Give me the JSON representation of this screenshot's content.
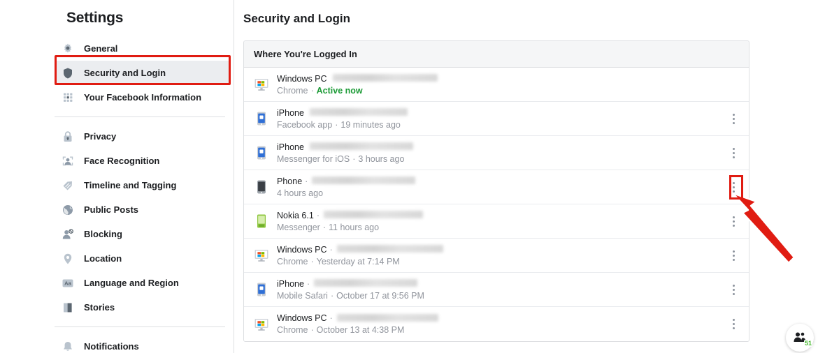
{
  "sidebar": {
    "title": "Settings",
    "groups": [
      {
        "items": [
          {
            "label": "General",
            "icon": "gear-icon",
            "active": false
          },
          {
            "label": "Security and Login",
            "icon": "shield-icon",
            "active": true
          },
          {
            "label": "Your Facebook Information",
            "icon": "grid-dots-icon",
            "active": false
          }
        ]
      },
      {
        "items": [
          {
            "label": "Privacy",
            "icon": "lock-icon",
            "active": false
          },
          {
            "label": "Face Recognition",
            "icon": "face-scan-icon",
            "active": false
          },
          {
            "label": "Timeline and Tagging",
            "icon": "tag-icon",
            "active": false
          },
          {
            "label": "Public Posts",
            "icon": "globe-icon",
            "active": false
          },
          {
            "label": "Blocking",
            "icon": "block-user-icon",
            "active": false
          },
          {
            "label": "Location",
            "icon": "map-pin-icon",
            "active": false
          },
          {
            "label": "Language and Region",
            "icon": "language-aa-icon",
            "active": false
          },
          {
            "label": "Stories",
            "icon": "book-icon",
            "active": false
          }
        ]
      },
      {
        "items": [
          {
            "label": "Notifications",
            "icon": "bell-icon",
            "active": false
          }
        ]
      }
    ]
  },
  "main": {
    "page_title": "Security and Login",
    "card": {
      "header": "Where You're Logged In",
      "rows": [
        {
          "device": "Windows PC",
          "icon": "windows-pc-icon",
          "redacted": true,
          "redact_width": 150,
          "has_separator": false,
          "app": "Chrome",
          "time": "Active now",
          "active": true,
          "kebab": false
        },
        {
          "device": "iPhone",
          "icon": "iphone-icon",
          "redacted": true,
          "redact_width": 140,
          "has_separator": false,
          "app": "Facebook app",
          "time": "19 minutes ago",
          "active": false,
          "kebab": true
        },
        {
          "device": "iPhone",
          "icon": "iphone-icon",
          "redacted": true,
          "redact_width": 148,
          "has_separator": false,
          "app": "Messenger for iOS",
          "time": "3 hours ago",
          "active": false,
          "kebab": true
        },
        {
          "device": "Phone",
          "icon": "phone-grey-icon",
          "redacted": true,
          "redact_width": 148,
          "has_separator": true,
          "app": "",
          "time": "4 hours ago",
          "active": false,
          "kebab": true
        },
        {
          "device": "Nokia 6.1",
          "icon": "nokia-green-icon",
          "redacted": true,
          "redact_width": 142,
          "has_separator": true,
          "app": "Messenger",
          "time": "11 hours ago",
          "active": false,
          "kebab": true
        },
        {
          "device": "Windows PC",
          "icon": "windows-pc-icon",
          "redacted": true,
          "redact_width": 152,
          "has_separator": true,
          "app": "Chrome",
          "time": "Yesterday at 7:14 PM",
          "active": false,
          "kebab": true
        },
        {
          "device": "iPhone",
          "icon": "iphone-icon",
          "redacted": true,
          "redact_width": 148,
          "has_separator": true,
          "app": "Mobile Safari",
          "time": "October 17 at 9:56 PM",
          "active": false,
          "kebab": true
        },
        {
          "device": "Windows PC",
          "icon": "windows-pc-icon",
          "redacted": true,
          "redact_width": 145,
          "has_separator": true,
          "app": "Chrome",
          "time": "October 13 at 4:38 PM",
          "active": false,
          "kebab": true
        }
      ]
    }
  },
  "annotations": {
    "highlight_color": "#e01c12",
    "highlight_security_label": "Security and Login",
    "highlight_kebab_row": "Phone",
    "arrow_color": "#e01c12"
  },
  "chat_widget": {
    "icon": "contacts-icon",
    "badge": "51"
  }
}
